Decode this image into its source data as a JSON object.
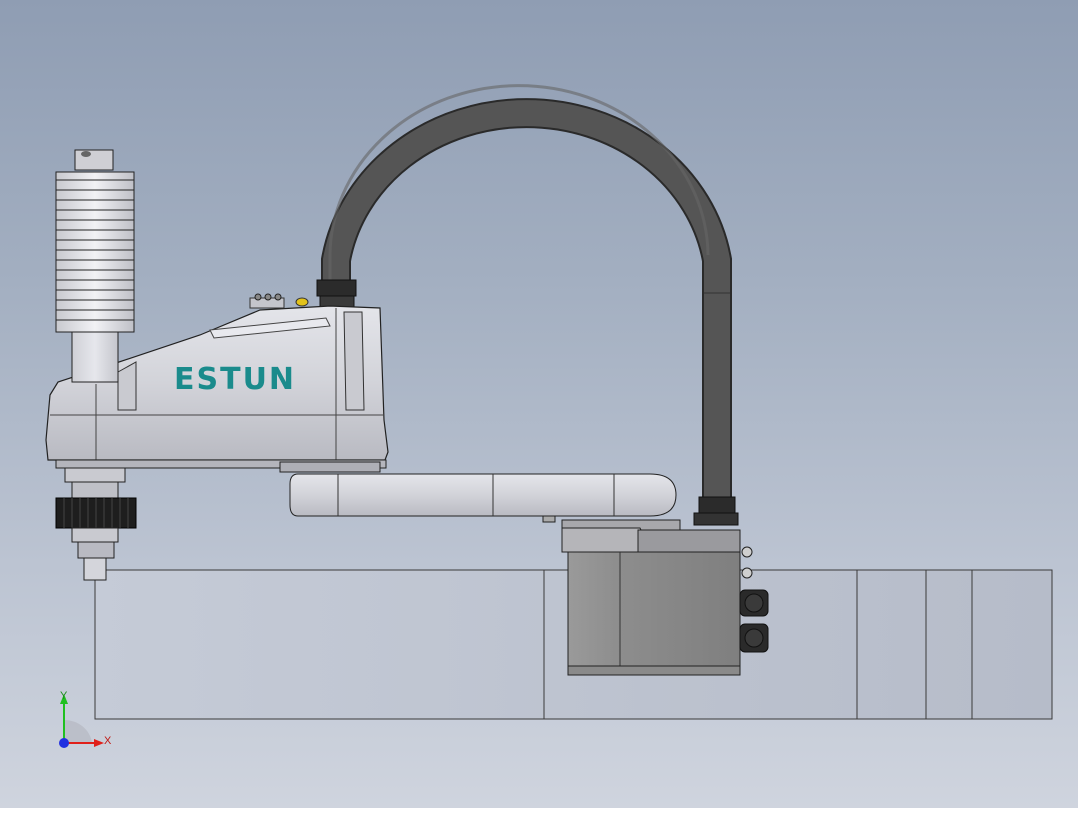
{
  "model": {
    "brand_label": "ESTUN"
  },
  "triad": {
    "x_label": "X",
    "y_label": "Y"
  },
  "colors": {
    "background_top": "#8f9db3",
    "background_bottom": "#cfd4de",
    "body_metal": "#d4d6dc",
    "cable": "#4a4a4a",
    "logo": "#1a8b8c",
    "axis_x": "#e0201a",
    "axis_y": "#20c020",
    "axis_z": "#2030e0"
  }
}
